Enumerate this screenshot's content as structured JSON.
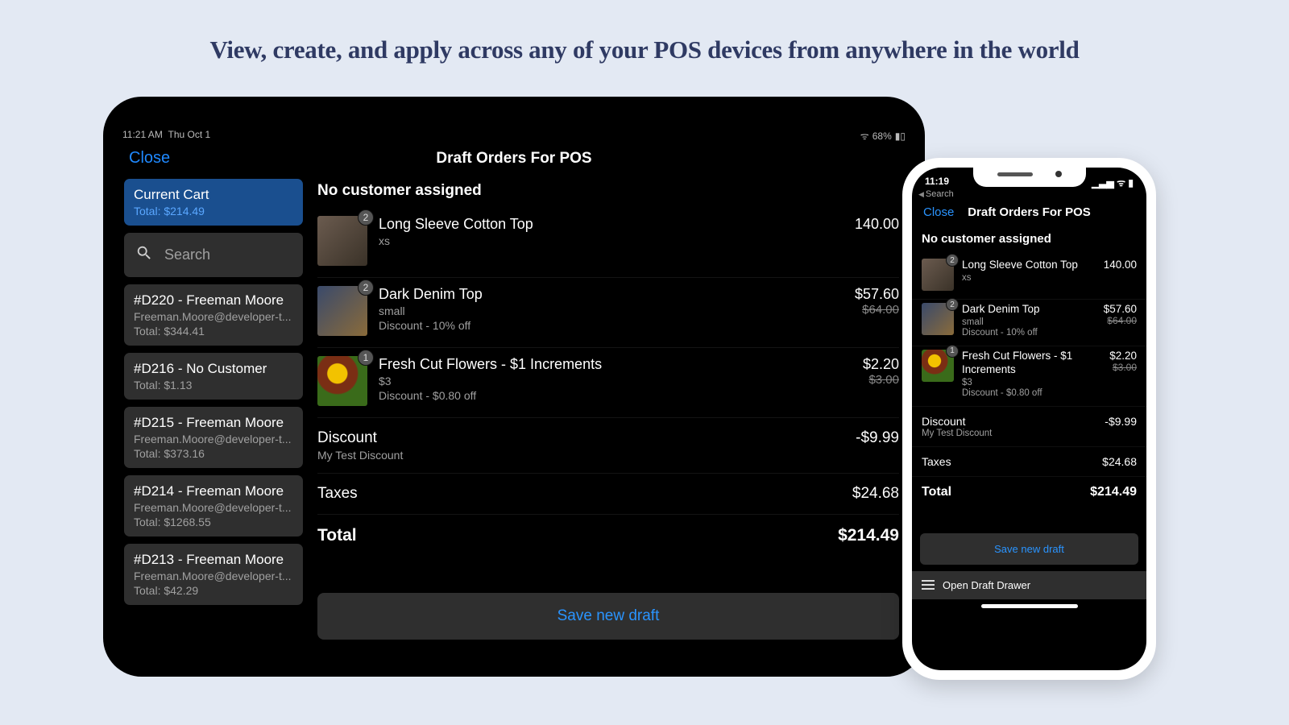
{
  "headline": "View, create, and apply across any of your POS devices from anywhere in the world",
  "tablet": {
    "status": {
      "time": "11:21 AM",
      "date": "Thu Oct 1",
      "battery": "68%"
    },
    "nav": {
      "close": "Close",
      "title": "Draft Orders For POS"
    },
    "sidebar": {
      "current": {
        "title": "Current Cart",
        "total": "Total: $214.49"
      },
      "search_placeholder": "Search",
      "drafts": [
        {
          "title": "#D220 - Freeman Moore",
          "email": "Freeman.Moore@developer-t...",
          "total": "Total: $344.41"
        },
        {
          "title": "#D216 - No Customer",
          "email": "",
          "total": "Total: $1.13"
        },
        {
          "title": "#D215 - Freeman Moore",
          "email": "Freeman.Moore@developer-t...",
          "total": "Total: $373.16"
        },
        {
          "title": "#D214 - Freeman Moore",
          "email": "Freeman.Moore@developer-t...",
          "total": "Total: $1268.55"
        },
        {
          "title": "#D213 - Freeman Moore",
          "email": "Freeman.Moore@developer-t...",
          "total": "Total: $42.29"
        }
      ]
    },
    "main": {
      "no_customer": "No customer assigned",
      "items": [
        {
          "qty": "2",
          "name": "Long Sleeve Cotton Top",
          "variant": "xs",
          "discount": "",
          "price": "140.00",
          "was": ""
        },
        {
          "qty": "2",
          "name": "Dark Denim Top",
          "variant": "small",
          "discount": "Discount - 10% off",
          "price": "$57.60",
          "was": "$64.00"
        },
        {
          "qty": "1",
          "name": "Fresh Cut Flowers - $1 Increments",
          "variant": "$3",
          "discount": "Discount - $0.80 off",
          "price": "$2.20",
          "was": "$3.00"
        }
      ],
      "discount": {
        "label": "Discount",
        "sub": "My Test Discount",
        "value": "-$9.99"
      },
      "taxes": {
        "label": "Taxes",
        "value": "$24.68"
      },
      "total": {
        "label": "Total",
        "value": "$214.49"
      },
      "save_label": "Save new draft"
    }
  },
  "phone": {
    "status_time": "11:19",
    "back_label": "Search",
    "nav": {
      "close": "Close",
      "title": "Draft Orders For POS"
    },
    "no_customer": "No customer assigned",
    "items": [
      {
        "qty": "2",
        "name": "Long Sleeve Cotton Top",
        "variant": "xs",
        "discount": "",
        "price": "140.00",
        "was": ""
      },
      {
        "qty": "2",
        "name": "Dark Denim Top",
        "variant": "small",
        "discount": "Discount - 10% off",
        "price": "$57.60",
        "was": "$64.00"
      },
      {
        "qty": "1",
        "name": "Fresh Cut Flowers - $1 Increments",
        "variant": "$3",
        "discount": "Discount - $0.80 off",
        "price": "$2.20",
        "was": "$3.00"
      }
    ],
    "discount": {
      "label": "Discount",
      "sub": "My Test Discount",
      "value": "-$9.99"
    },
    "taxes": {
      "label": "Taxes",
      "value": "$24.68"
    },
    "total": {
      "label": "Total",
      "value": "$214.49"
    },
    "save_label": "Save new draft",
    "drawer_label": "Open Draft Drawer"
  }
}
